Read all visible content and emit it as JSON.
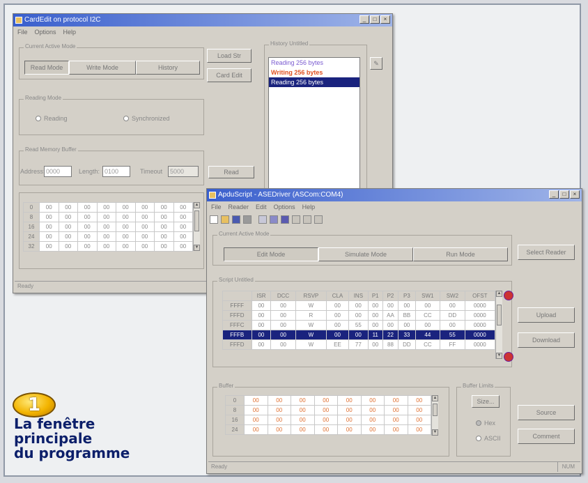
{
  "win1": {
    "title": "CardEdit on protocol I2C",
    "menu": [
      "File",
      "Options",
      "Help"
    ],
    "mode_group": "Current Active Mode",
    "mode_tabs": [
      "Read Mode",
      "Write Mode",
      "History"
    ],
    "side_buttons": [
      "Load Str",
      "Card Edit"
    ],
    "reading_group": "Reading Mode",
    "reading_radios": [
      "Reading",
      "Synchronized"
    ],
    "buffer_group": "Read Memory Buffer",
    "address_label": "Address:",
    "address_value": "0000",
    "length_label": "Length:",
    "length_value": "0100",
    "timeout_label": "Timeout",
    "timeout_value": "5000",
    "read_button": "Read",
    "history_group": "History Untitled",
    "history": [
      "Reading 256 bytes",
      "Writing 256 bytes",
      "Reading 256 bytes"
    ],
    "status": "Ready",
    "grid": {
      "rows": [
        {
          "h": "0",
          "v": [
            "00",
            "00",
            "00",
            "00",
            "00",
            "00",
            "00",
            "00"
          ]
        },
        {
          "h": "8",
          "v": [
            "00",
            "00",
            "00",
            "00",
            "00",
            "00",
            "00",
            "00"
          ]
        },
        {
          "h": "16",
          "v": [
            "00",
            "00",
            "00",
            "00",
            "00",
            "00",
            "00",
            "00"
          ]
        },
        {
          "h": "24",
          "v": [
            "00",
            "00",
            "00",
            "00",
            "00",
            "00",
            "00",
            "00"
          ]
        },
        {
          "h": "32",
          "v": [
            "00",
            "00",
            "00",
            "00",
            "00",
            "00",
            "00",
            "00"
          ]
        }
      ]
    }
  },
  "win2": {
    "title": "ApduScript - ASEDriver (ASCom:COM4)",
    "menu": [
      "File",
      "Reader",
      "Edit",
      "Options",
      "Help"
    ],
    "mode_group": "Current Active Mode",
    "mode_tabs": [
      "Edit Mode",
      "Simulate Mode",
      "Run Mode"
    ],
    "select_reader": "Select Reader",
    "script_group": "Script Untitled",
    "script_headers": [
      "",
      "ISR",
      "DCC",
      "RSVP",
      "CLA",
      "INS",
      "P1",
      "P2",
      "P3",
      "SW1",
      "SW2",
      "OFST"
    ],
    "script_rows": [
      [
        "FFFF",
        "00",
        "00",
        "W",
        "00",
        "00",
        "00",
        "00",
        "00",
        "00",
        "00",
        "0000"
      ],
      [
        "FFFD",
        "00",
        "00",
        "R",
        "00",
        "00",
        "00",
        "AA",
        "BB",
        "CC",
        "DD",
        "0000"
      ],
      [
        "FFFC",
        "00",
        "00",
        "W",
        "00",
        "55",
        "00",
        "00",
        "00",
        "00",
        "00",
        "0000"
      ],
      [
        "FFFB",
        "00",
        "00",
        "W",
        "00",
        "00",
        "11",
        "22",
        "33",
        "44",
        "55",
        "0000"
      ],
      [
        "FFFD",
        "00",
        "00",
        "W",
        "EE",
        "77",
        "00",
        "88",
        "DD",
        "CC",
        "FF",
        "0000"
      ]
    ],
    "upload": "Upload",
    "download": "Download",
    "buffer_group": "Buffer",
    "buffer_rows": [
      {
        "h": "0",
        "v": [
          "00",
          "00",
          "00",
          "00",
          "00",
          "00",
          "00",
          "00"
        ]
      },
      {
        "h": "8",
        "v": [
          "00",
          "00",
          "00",
          "00",
          "00",
          "00",
          "00",
          "00"
        ]
      },
      {
        "h": "16",
        "v": [
          "00",
          "00",
          "00",
          "00",
          "00",
          "00",
          "00",
          "00"
        ]
      },
      {
        "h": "24",
        "v": [
          "00",
          "00",
          "00",
          "00",
          "00",
          "00",
          "00",
          "00"
        ]
      }
    ],
    "buffer_limits_group": "Buffer Limits",
    "size_button": "Size...",
    "radios": [
      "Hex",
      "ASCII"
    ],
    "source_button": "Source",
    "comment_button": "Comment",
    "status": "Ready",
    "status_right": "NUM"
  },
  "badge": "1",
  "caption": [
    "La fenêtre",
    "principale",
    "du programme"
  ]
}
